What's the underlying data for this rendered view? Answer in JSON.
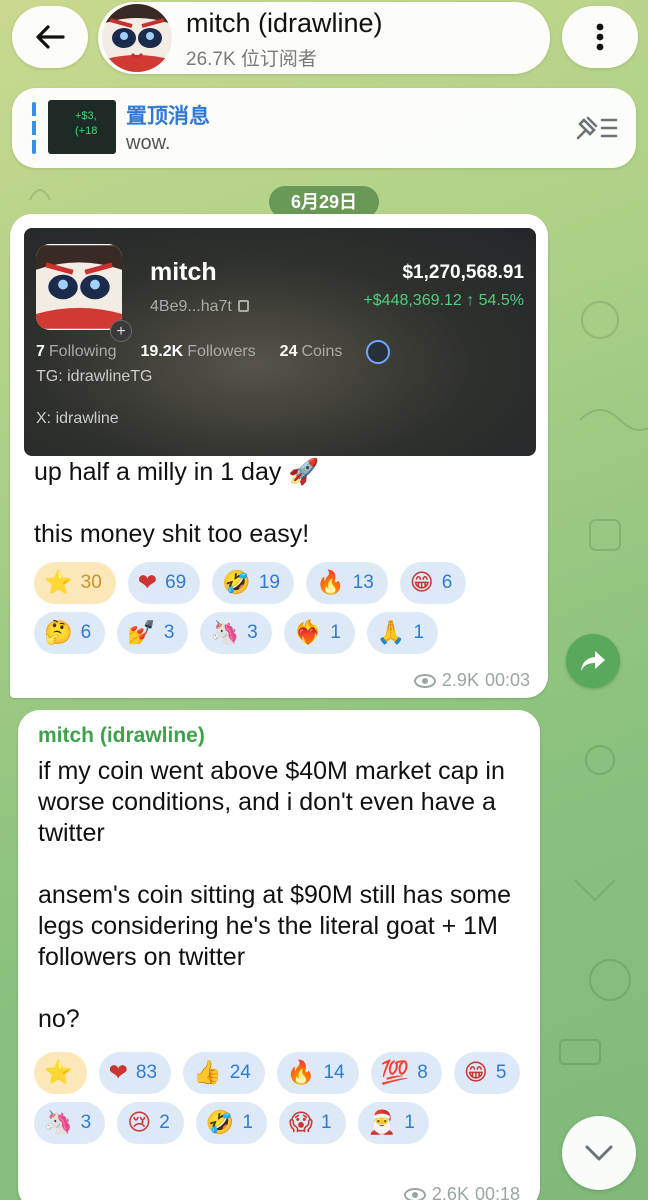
{
  "header": {
    "title": "mitch (idrawline)",
    "subscribers": "26.7K 位订阅者"
  },
  "pinned": {
    "title": "置顶消息",
    "text": "wow.",
    "thumb_line1": "+$3,",
    "thumb_line2": "(+18"
  },
  "date_label": "6月29日",
  "post1": {
    "card": {
      "name": "mitch",
      "address": "4Be9...ha7t",
      "balance": "$1,270,568.91",
      "gain": "+$448,369.12 ↑ 54.5%",
      "following_count": "7",
      "following_label": "Following",
      "followers_count": "19.2K",
      "followers_label": "Followers",
      "coins_count": "24",
      "coins_label": "Coins",
      "tg": "TG: idrawlineTG",
      "x": "X: idrawline"
    },
    "text": "up half a milly in 1 day 🚀\n\nthis money shit too easy!",
    "reactions": [
      {
        "emoji": "⭐",
        "count": "30",
        "type": "star"
      },
      {
        "emoji": "❤",
        "count": "69"
      },
      {
        "emoji": "🤣",
        "count": "19"
      },
      {
        "emoji": "🔥",
        "count": "13"
      },
      {
        "emoji": "😁",
        "count": "6"
      },
      {
        "emoji": "🤔",
        "count": "6"
      },
      {
        "emoji": "💅",
        "count": "3"
      },
      {
        "emoji": "🦄",
        "count": "3"
      },
      {
        "emoji": "❤‍🔥",
        "count": "1"
      },
      {
        "emoji": "🙏",
        "count": "1"
      }
    ],
    "views": "2.9K",
    "time": "00:03"
  },
  "post2": {
    "sender": "mitch (idrawline)",
    "text": "if my coin went above $40M market cap in worse conditions, and i don't even have a twitter\n\nansem's coin sitting at $90M still has some legs considering he's the literal goat + 1M followers on twitter\n\nno?",
    "reactions": [
      {
        "emoji": "⭐",
        "count": "",
        "type": "star"
      },
      {
        "emoji": "❤",
        "count": "83"
      },
      {
        "emoji": "👍",
        "count": "24"
      },
      {
        "emoji": "🔥",
        "count": "14"
      },
      {
        "emoji": "💯",
        "count": "8"
      },
      {
        "emoji": "😁",
        "count": "5"
      },
      {
        "emoji": "🦄",
        "count": "3"
      },
      {
        "emoji": "😢",
        "count": "2"
      },
      {
        "emoji": "🤣",
        "count": "1"
      },
      {
        "emoji": "😱",
        "count": "1"
      },
      {
        "emoji": "🎅",
        "count": "1"
      }
    ],
    "views": "2.6K",
    "time": "00:18"
  }
}
